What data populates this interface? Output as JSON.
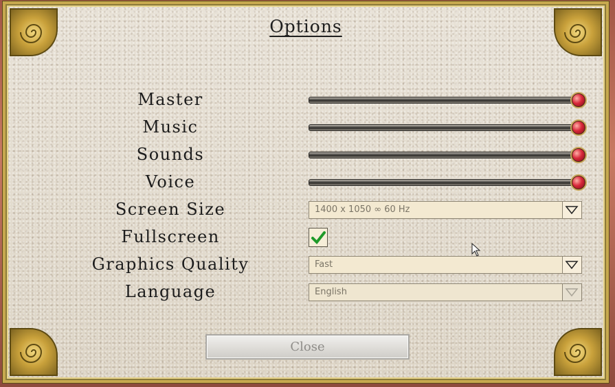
{
  "dialog": {
    "title": "Options",
    "close_label": "Close"
  },
  "settings": {
    "master_label": "Master",
    "master_level": 1.0,
    "music_label": "Music",
    "music_level": 1.0,
    "sounds_label": "Sounds",
    "sounds_level": 1.0,
    "voice_label": "Voice",
    "voice_level": 1.0,
    "screen_size_label": "Screen Size",
    "screen_size_value": "1400 x 1050 ∞ 60 Hz",
    "fullscreen_label": "Fullscreen",
    "fullscreen_checked": true,
    "graphics_quality_label": "Graphics Quality",
    "graphics_quality_value": "Fast",
    "language_label": "Language",
    "language_value": "English"
  },
  "colors": {
    "knob": "#d8283a",
    "gold": "#c7a94f",
    "check": "#1f9a2a"
  }
}
